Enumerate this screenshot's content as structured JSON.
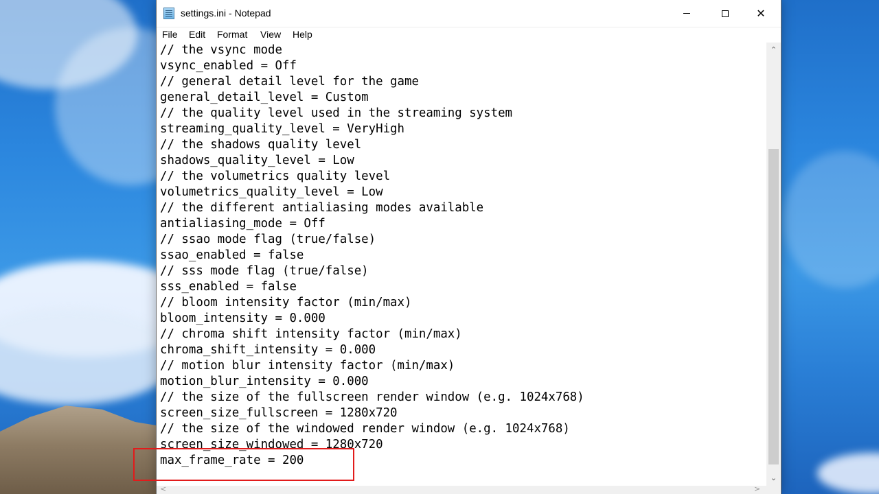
{
  "window": {
    "title": "settings.ini - Notepad",
    "icon": "notepad-icon",
    "controls": {
      "minimize": "minimize-icon",
      "maximize": "maximize-icon",
      "close": "close-icon",
      "close_glyph": "✕"
    }
  },
  "menu": [
    "File",
    "Edit",
    "Format",
    "View",
    "Help"
  ],
  "content": {
    "lines": [
      "// the vsync mode",
      "vsync_enabled = Off",
      "// general detail level for the game",
      "general_detail_level = Custom",
      "// the quality level used in the streaming system",
      "streaming_quality_level = VeryHigh",
      "// the shadows quality level",
      "shadows_quality_level = Low",
      "// the volumetrics quality level",
      "volumetrics_quality_level = Low",
      "// the different antialiasing modes available",
      "antialiasing_mode = Off",
      "// ssao mode flag (true/false)",
      "ssao_enabled = false",
      "// sss mode flag (true/false)",
      "sss_enabled = false",
      "// bloom intensity factor (min/max)",
      "bloom_intensity = 0.000",
      "// chroma shift intensity factor (min/max)",
      "chroma_shift_intensity = 0.000",
      "// motion blur intensity factor (min/max)",
      "motion_blur_intensity = 0.000",
      "// the size of the fullscreen render window (e.g. 1024x768)",
      "screen_size_fullscreen = 1280x720",
      "// the size of the windowed render window (e.g. 1024x768)",
      "screen_size_windowed = 1280x720",
      "max_frame_rate = 200"
    ]
  },
  "scrollbar": {
    "up_glyph": "⌃",
    "down_glyph": "⌄",
    "left_glyph": "<",
    "right_glyph": ">"
  },
  "annotation": {
    "color": "#e21b1b"
  }
}
